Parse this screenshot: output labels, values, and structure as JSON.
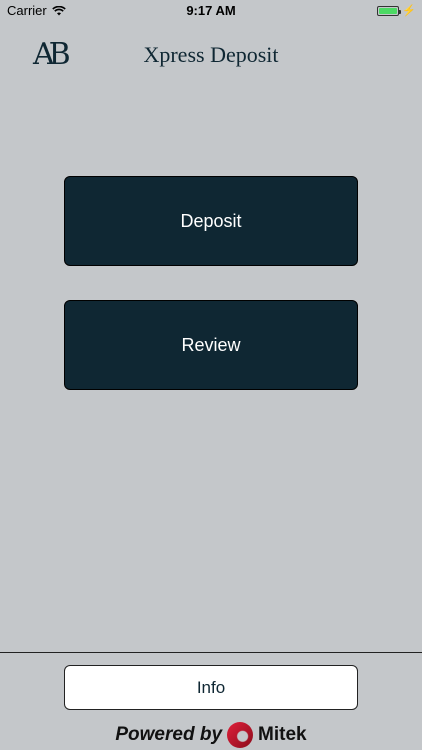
{
  "status_bar": {
    "carrier": "Carrier",
    "time": "9:17 AM",
    "battery_level": 1.0,
    "battery_color": "#4cd964"
  },
  "nav": {
    "logo_text": "AB",
    "title": "Xpress Deposit"
  },
  "actions": {
    "deposit_label": "Deposit",
    "review_label": "Review"
  },
  "footer": {
    "info_label": "Info",
    "powered_by": "Powered by",
    "brand": "Mitek"
  },
  "colors": {
    "background": "#c4c7ca",
    "button_primary": "#0f2733",
    "button_text": "#ffffff",
    "brand_red": "#e0203a"
  }
}
